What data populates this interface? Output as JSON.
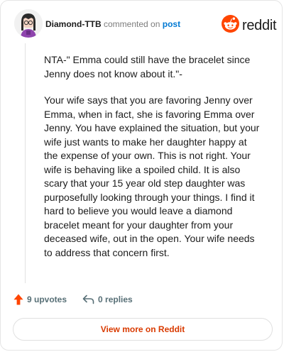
{
  "header": {
    "username": "Diamond-TTB",
    "action_text": "commented on",
    "post_link": "post"
  },
  "brand": {
    "name": "reddit",
    "icon": "reddit-snoo-icon",
    "color": "#ff4500"
  },
  "comment": {
    "paragraphs": [
      "NTA-\" Emma could still have the bracelet since Jenny does not know about it.\"-",
      "Your wife says that you are favoring Jenny over Emma, when in fact, she is favoring Emma over Jenny. You have explained the situation, but your wife just wants to make her daughter happy at the expense of your own. This is not right. Your wife is behaving like a spoiled child. It is also scary that your 15 year old step daughter was purposefully looking through your things. I find it hard to believe you would leave a diamond bracelet meant for your daughter from your deceased wife, out in the open. Your wife needs to address that concern first."
    ]
  },
  "footer": {
    "upvotes": "9 upvotes",
    "replies": "0 replies",
    "upvote_icon": "upvote-arrow-icon",
    "reply_icon": "reply-arrow-icon",
    "view_more": "View more on Reddit"
  },
  "colors": {
    "accent": "#d93a00",
    "link": "#0079d3",
    "muted": "#576f76"
  }
}
